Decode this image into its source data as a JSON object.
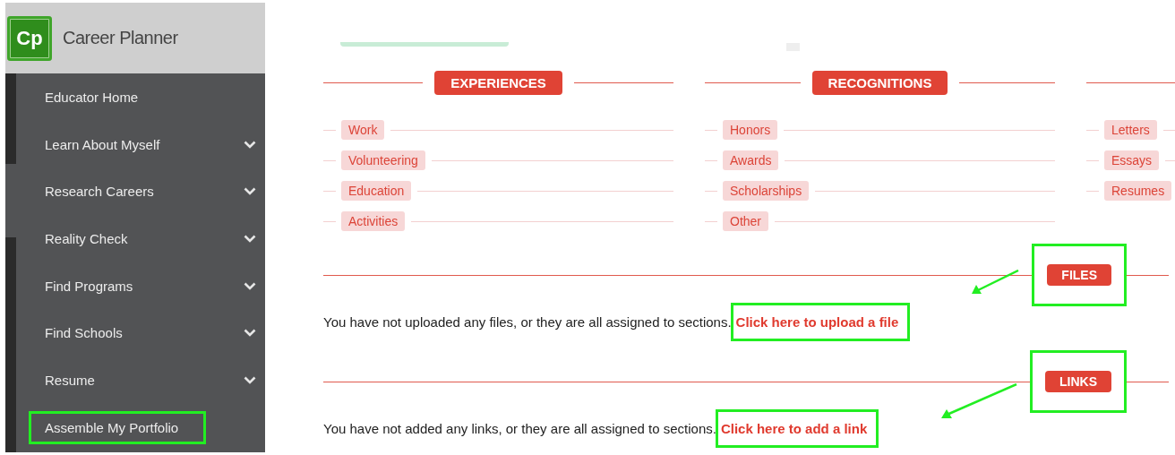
{
  "sidebar": {
    "logo": "Cp",
    "title": "Career Planner",
    "items": [
      {
        "label": "Educator Home",
        "expandable": false,
        "highlighted": false
      },
      {
        "label": "Learn About Myself",
        "expandable": true,
        "highlighted": false
      },
      {
        "label": "Research Careers",
        "expandable": true,
        "highlighted": false
      },
      {
        "label": "Reality Check",
        "expandable": true,
        "highlighted": false
      },
      {
        "label": "Find Programs",
        "expandable": true,
        "highlighted": false
      },
      {
        "label": "Find Schools",
        "expandable": true,
        "highlighted": false
      },
      {
        "label": "Resume",
        "expandable": true,
        "highlighted": false
      },
      {
        "label": "Assemble My Portfolio",
        "expandable": false,
        "highlighted": true
      }
    ]
  },
  "categories": [
    {
      "title": "EXPERIENCES",
      "tags": [
        "Work",
        "Volunteering",
        "Education",
        "Activities"
      ]
    },
    {
      "title": "RECOGNITIONS",
      "tags": [
        "Honors",
        "Awards",
        "Scholarships",
        "Other"
      ]
    },
    {
      "tags": [
        "Letters",
        "Essays",
        "Resumes"
      ]
    }
  ],
  "sections": [
    {
      "title": "FILES",
      "highlighted": true,
      "message": "You have not uploaded any files, or they are all assigned to sections.",
      "link": {
        "label": "Click here to upload a file",
        "highlighted": true
      }
    },
    {
      "title": "LINKS",
      "highlighted": true,
      "message": "You have not added any links, or they are all assigned to sections.",
      "link": {
        "label": "Click here to add a link",
        "highlighted": true
      }
    }
  ]
}
